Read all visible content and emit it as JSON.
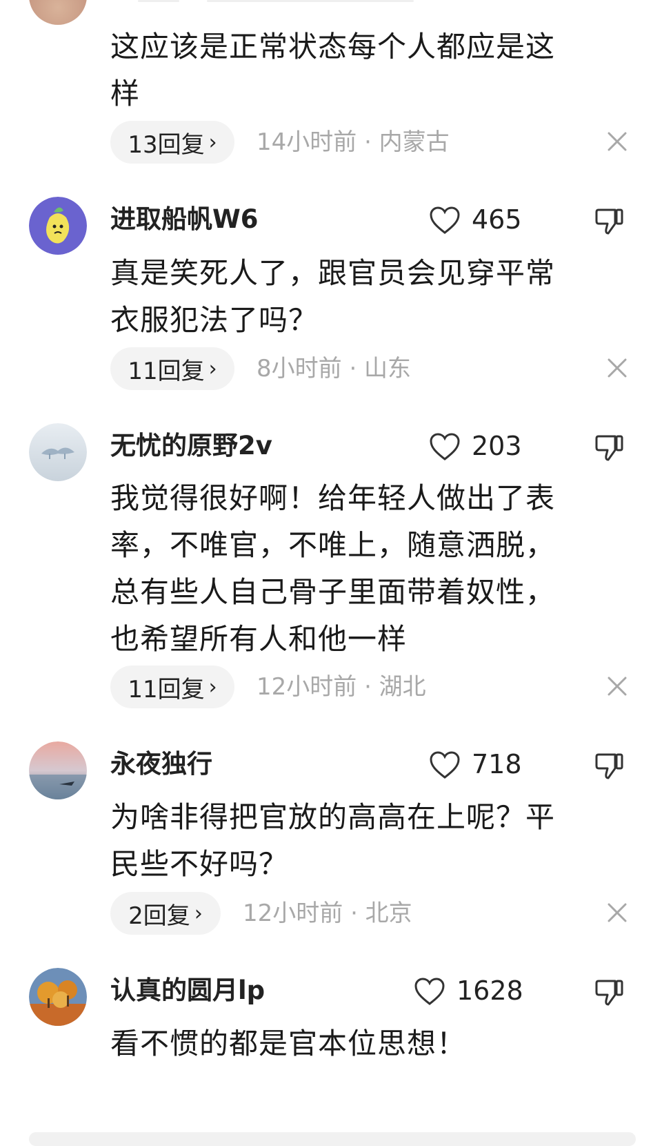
{
  "comments": [
    {
      "username": "",
      "text_lines": [
        "这应该是正常状态每个人都应是这",
        "样"
      ],
      "reply_label": "13回复",
      "meta": "14小时前 · 内蒙古"
    },
    {
      "username": "进取船帆W6",
      "likes": "465",
      "text_lines": [
        "真是笑死人了，跟官员会见穿平常",
        "衣服犯法了吗？"
      ],
      "reply_label": "11回复",
      "meta": "8小时前 · 山东"
    },
    {
      "username": "无忧的原野2v",
      "likes": "203",
      "text_lines": [
        "我觉得很好啊！给年轻人做出了表",
        "率，不唯官，不唯上，随意洒脱，",
        "总有些人自己骨子里面带着奴性，",
        "也希望所有人和他一样"
      ],
      "reply_label": "11回复",
      "meta": "12小时前 · 湖北"
    },
    {
      "username": "永夜独行",
      "likes": "718",
      "text_lines": [
        "为啥非得把官放的高高在上呢？平",
        "民些不好吗？"
      ],
      "reply_label": "2回复",
      "meta": "12小时前 · 北京"
    },
    {
      "username": "认真的圆月lp",
      "likes": "1628",
      "text_lines": [
        "看不惯的都是官本位思想！"
      ]
    }
  ],
  "chevron": "›",
  "icons": {
    "like": "heart-outline-icon",
    "dislike": "thumbs-down-icon",
    "close": "close-x-icon"
  },
  "colors": {
    "meta_text": "#a8a8a8",
    "pill_bg": "#f3f3f3",
    "icon_stroke": "#333333"
  }
}
